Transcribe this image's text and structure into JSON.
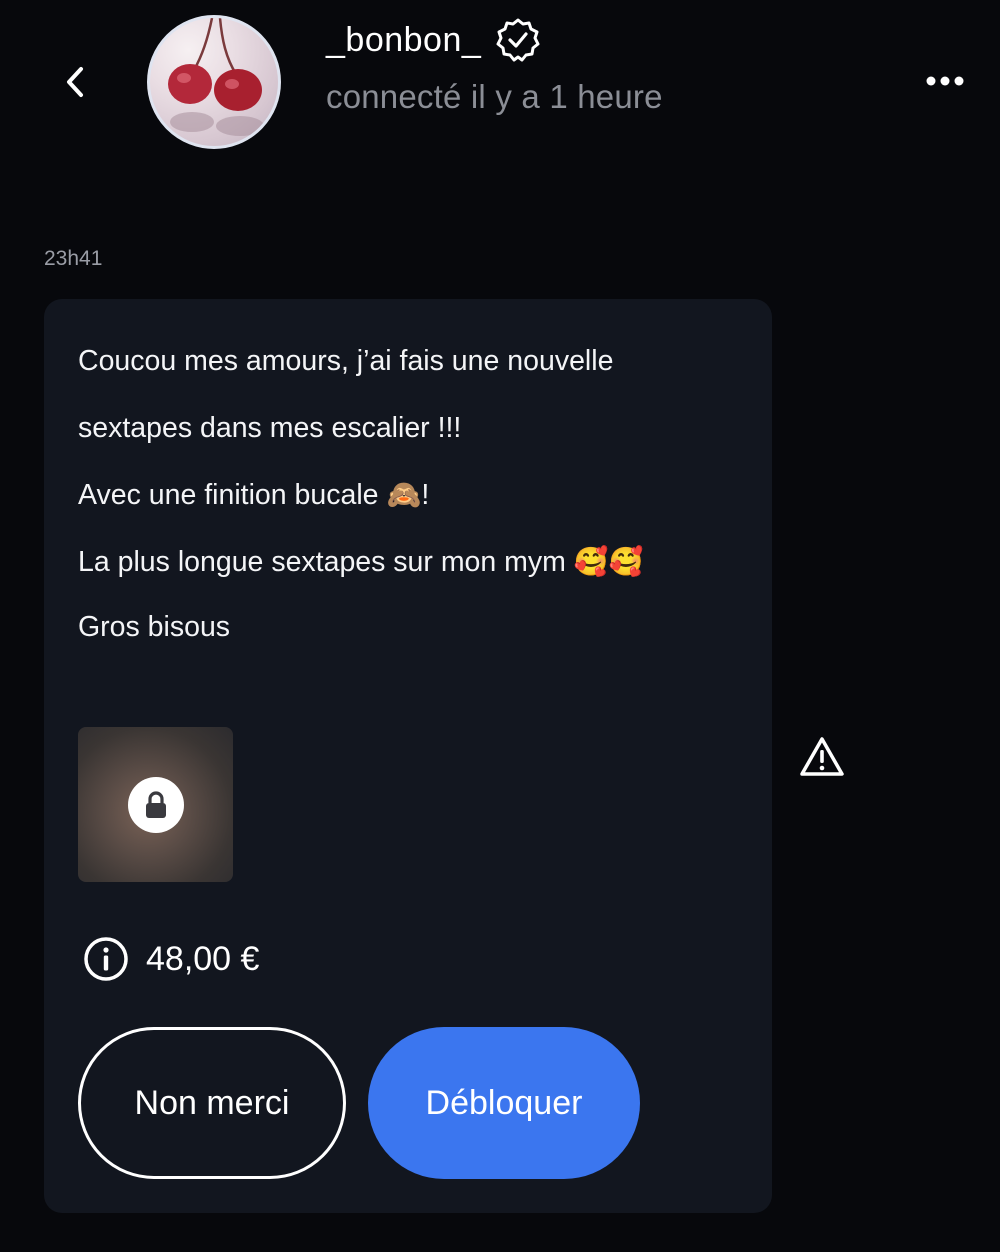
{
  "header": {
    "username": "_bonbon_",
    "status": "connecté il y a 1 heure",
    "back_icon": "chevron-left-icon",
    "verified_icon": "verified-badge-icon",
    "more_icon": "more-horizontal-icon"
  },
  "conversation": {
    "timestamp": "23h41",
    "message": {
      "lines": [
        "Coucou mes amours, j’ai fais une nouvelle",
        "sextapes dans mes escalier !!!",
        "Avec une finition bucale ",
        "La plus longue sextapes sur mon mym ",
        "Gros bisous"
      ],
      "line3_emoji": "🙈",
      "line3_suffix": "!",
      "line4_emoji": "🥰🥰"
    },
    "media": {
      "locked": true,
      "lock_icon": "lock-icon"
    },
    "price": "48,00 €",
    "info_icon": "info-icon",
    "buttons": {
      "decline_label": "Non merci",
      "unlock_label": "Débloquer"
    },
    "report_icon": "warning-triangle-icon"
  },
  "colors": {
    "background": "#07080c",
    "card": "#12161f",
    "accent": "#3b76ef",
    "muted_text": "#8b8e96"
  }
}
